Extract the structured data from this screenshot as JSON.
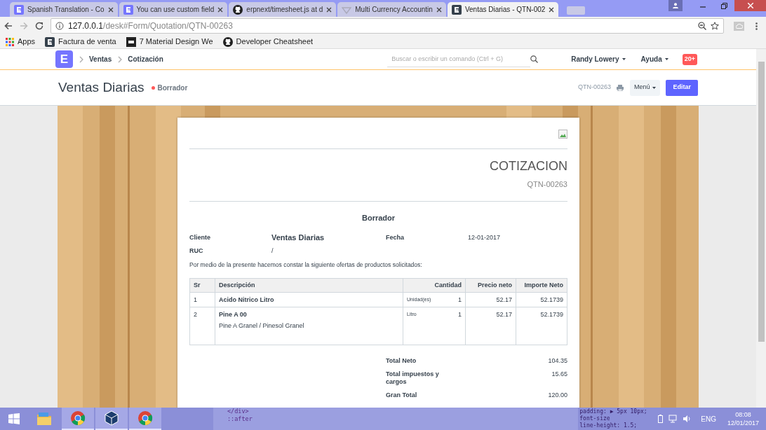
{
  "browser": {
    "tabs": [
      {
        "title": "Spanish Translation - Co",
        "kind": "erp",
        "selected": false
      },
      {
        "title": "You can use custom field",
        "kind": "erp",
        "selected": false
      },
      {
        "title": "erpnext/timesheet.js at d",
        "kind": "github",
        "selected": false
      },
      {
        "title": "Multi Currency Accountin",
        "kind": "other",
        "selected": false
      },
      {
        "title": "Ventas Diarias - QTN-002",
        "kind": "erpdark",
        "selected": true
      }
    ],
    "url_host": "127.0.0.1",
    "url_path": "/desk#Form/Quotation/QTN-00263",
    "bookmarks": [
      {
        "label": "Apps",
        "kind": "apps"
      },
      {
        "label": "Factura de venta",
        "kind": "erpdark"
      },
      {
        "label": "7 Material Design We",
        "kind": "md"
      },
      {
        "label": "Developer Cheatsheet",
        "kind": "github"
      }
    ]
  },
  "navbar": {
    "logo": "E",
    "breadcrumbs": [
      "Ventas",
      "Cotización"
    ],
    "search": {
      "placeholder": "Buscar o escribir un comando (Ctrl + G)"
    },
    "user": "Randy Lowery",
    "help": "Ayuda",
    "notifications": "20+"
  },
  "page_header": {
    "title": "Ventas Diarias",
    "status": "Borrador",
    "doc_id": "QTN-00263",
    "menu": "Menú",
    "edit": "Editar"
  },
  "document": {
    "heading": "COTIZACION",
    "number": "QTN-00263",
    "status": "Borrador",
    "fields": [
      {
        "label": "Cliente",
        "value": "Ventas Diarias",
        "emphasis": true
      },
      {
        "label": "Fecha",
        "value": "12-01-2017",
        "emphasis": false
      },
      {
        "label": "RUC",
        "value": "/",
        "emphasis": false
      }
    ],
    "intro": "Por medio de la presente hacemos constar la siguiente ofertas de productos solicitados:",
    "table": {
      "columns": [
        "Sr",
        "Descripción",
        "Cantidad",
        "Precio neto",
        "Importe Neto"
      ],
      "rows": [
        {
          "sr": "1",
          "item": "Acido Nitrico Litro",
          "uom": "Unidad(es)",
          "qty": "1",
          "rate": "52.17",
          "amount": "52.1739"
        },
        {
          "sr": "2",
          "item": "Pine A 00",
          "description": "Pine A Granel / Pinesol Granel",
          "uom": "Litro",
          "qty": "1",
          "rate": "52.17",
          "amount": "52.1739"
        }
      ]
    },
    "totals": [
      {
        "label": "Total Neto",
        "value": "104.35"
      },
      {
        "label": "Total impuestos y cargos",
        "value": "15.65"
      },
      {
        "label": "Gran Total",
        "value": "120.00"
      }
    ]
  },
  "devtools": {
    "code_lines": [
      "</div>",
      "::after"
    ],
    "style_lines": [
      "padding: ▶ 5px 10px;",
      "font-size",
      "line-height: 1.5;"
    ]
  },
  "taskbar": {
    "language": "ENG",
    "time": "08:08",
    "date": "12/01/2017"
  }
}
